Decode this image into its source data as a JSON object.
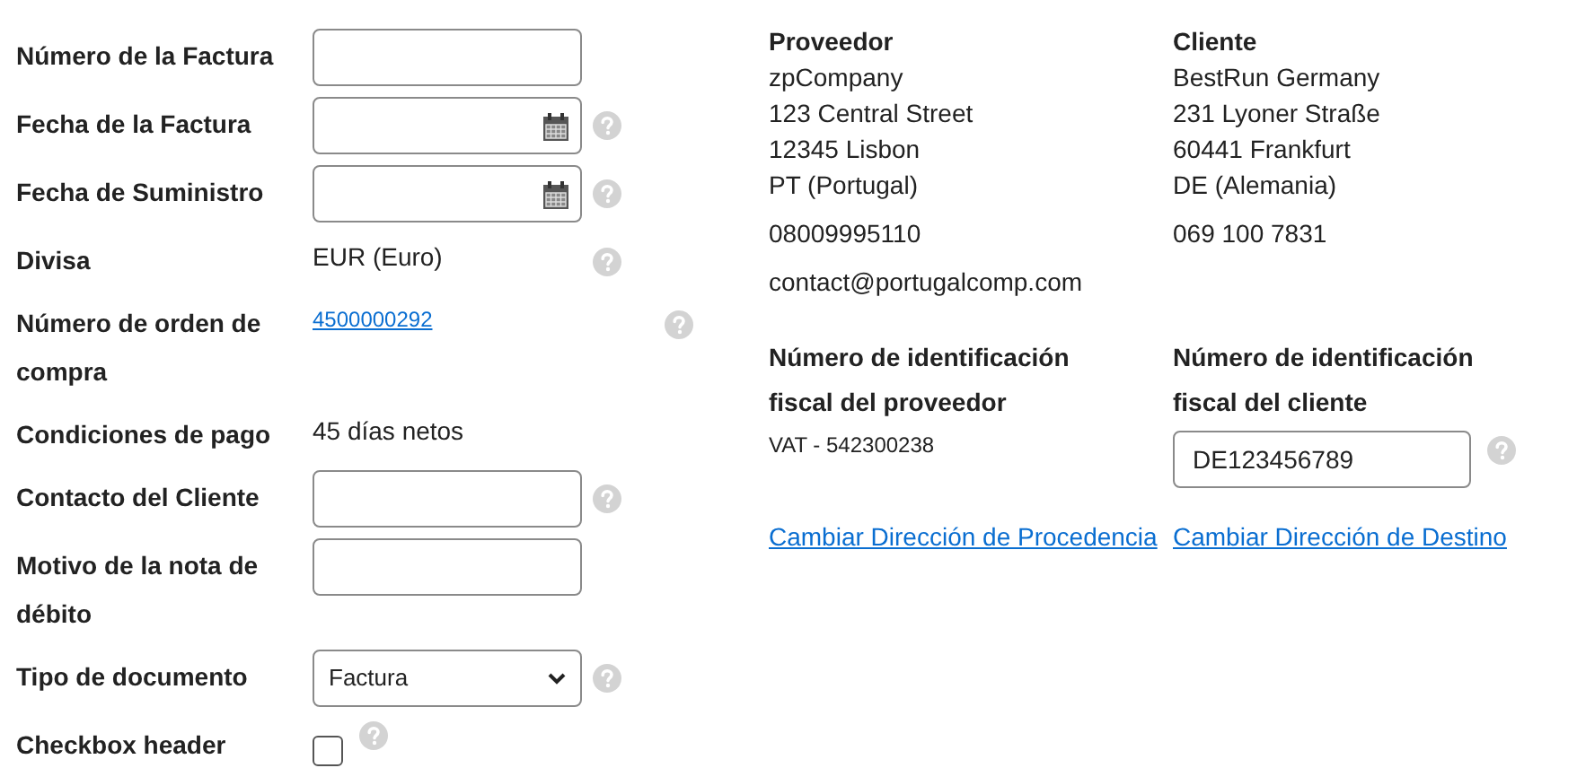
{
  "fields": [
    {
      "label": "Número de la Factura",
      "kind": "text_input",
      "help": false
    },
    {
      "label": "Fecha de la Factura",
      "kind": "date_input",
      "help": true
    },
    {
      "label": "Fecha de Suministro",
      "kind": "date_input",
      "help": true
    },
    {
      "label": "Divisa",
      "kind": "text",
      "value": "EUR (Euro)",
      "help": true
    },
    {
      "label": "Número de orden de compra",
      "kind": "link",
      "value": "4500000292",
      "help": true
    },
    {
      "label": "Condiciones de pago",
      "kind": "text",
      "value": "45 días netos",
      "help": false
    },
    {
      "label": "Contacto del Cliente",
      "kind": "text_input",
      "help": true
    },
    {
      "label": "Motivo de la nota de débito",
      "kind": "text_input",
      "help": false
    },
    {
      "label": "Tipo de documento",
      "kind": "select",
      "value": "Factura",
      "help": true
    },
    {
      "label": "Checkbox header",
      "kind": "checkbox",
      "checked": false,
      "help": true
    }
  ],
  "parties": [
    {
      "heading": "Proveedor",
      "address": [
        "zpCompany",
        "123 Central Street",
        "12345 Lisbon",
        "PT (Portugal)"
      ],
      "phone": "08009995110",
      "email": "contact@portugalcomp.com",
      "tax": {
        "label": "Número de identificación fiscal del proveedor",
        "kind": "text",
        "value": "VAT - 542300238",
        "help": false
      },
      "link": "Cambiar Dirección de Procedencia"
    },
    {
      "heading": "Cliente",
      "address": [
        "BestRun Germany",
        "231 Lyoner Straße",
        "60441 Frankfurt",
        "DE (Alemania)"
      ],
      "phone": "069 100 7831",
      "tax": {
        "label": "Número de identificación fiscal del cliente",
        "kind": "input",
        "value": "DE123456789",
        "help": true
      },
      "link": "Cambiar Dirección de Destino"
    }
  ]
}
